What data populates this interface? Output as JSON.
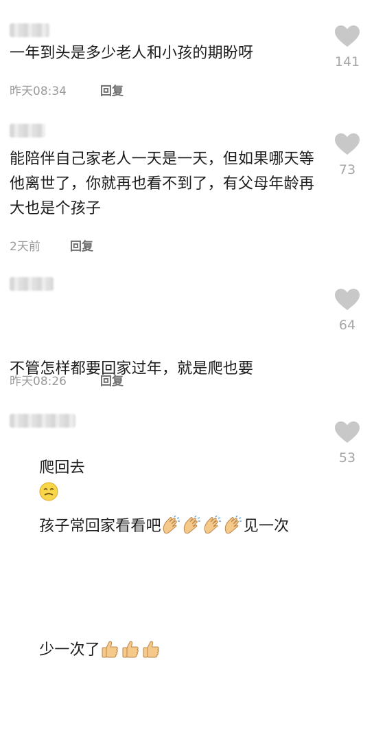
{
  "comments": [
    {
      "text": "一年到头是多少老人和小孩的期盼呀",
      "time": "昨天08:34",
      "reply": "回复",
      "likes": "141"
    },
    {
      "text": "能陪伴自己家老人一天是一天，但如果哪天等他离世了，你就再也看不到了，有父母年龄再大也是个孩子",
      "time": "2天前",
      "reply": "回复",
      "likes": "73"
    },
    {
      "text_line1": "不管怎样都要回家过年，就是爬也要",
      "text_line2": "爬回去",
      "time": "昨天08:26",
      "reply": "回复",
      "likes": "64"
    },
    {
      "text_line1_a": "孩子常回家看看吧",
      "text_line1_b": "见一次",
      "text_line2": "少一次了",
      "likes": "53"
    }
  ],
  "icons": {
    "like": "heart-icon",
    "clap": "clapping-hands-emoji",
    "thumbs": "thumbs-up-emoji",
    "smirk": "squinting-face-emoji"
  },
  "colors": {
    "heart": "#c8c8c8",
    "meta_text": "#9a9a9a",
    "reply_text": "#6e6e6e",
    "like_count": "#a6a6a6"
  }
}
